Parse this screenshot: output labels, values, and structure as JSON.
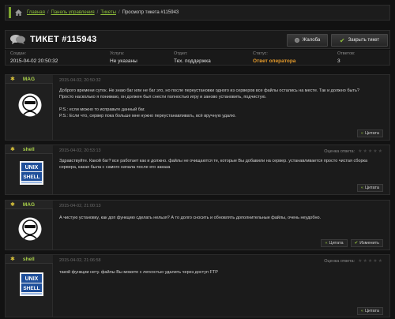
{
  "breadcrumb": {
    "home": "Главная",
    "panel": "Панель управления",
    "tickets": "Тикеты",
    "current": "Просмотр тикета #115943",
    "separator": "/"
  },
  "header": {
    "title": "ТИКЕТ #115943",
    "complaint_label": "Жалоба",
    "close_label": "Закрыть тикет"
  },
  "info": {
    "created_label": "Создан:",
    "created_value": "2015-04-02 20:50:32",
    "service_label": "Услуга:",
    "service_value": "Не указаны",
    "dept_label": "Отдел:",
    "dept_value": "Тех. поддержка",
    "status_label": "Статус:",
    "status_value": "Ответ оператора",
    "replies_label": "Ответов:",
    "replies_value": "3"
  },
  "messages": [
    {
      "author": "MAG",
      "date": "2015-04-02, 20:50:32",
      "lines": [
        "Доброго времени суток. Не знаю баг или не баг это, но после переустановки одного из серверов все файлы остались на месте. Так и должно быть?",
        "Просто насколько я понимаю, он должен был снести полностью игру и заново установить, подчистую.",
        "",
        "P.S.: если можно то исправьте данный баг.",
        "P.S.: Если что, сервер пока больше мне нужно переустанавливать, всё вручную удалю."
      ],
      "quote_label": "Цитата"
    },
    {
      "author": "shell",
      "date": "2015-04-02, 20:53:13",
      "rating_label": "Оценка ответа:",
      "lines": [
        "Здравствуйте. Какой баг? все работает как и должно. файлы не очищаются те, которые Вы добавили на сервер. устанавливается просто чистая сборка",
        "сервера, какая была с самого начала после его заказа"
      ],
      "quote_label": "Цитата"
    },
    {
      "author": "MAG",
      "date": "2015-04-02, 21:00:13",
      "lines": [
        "А чистую установку, как доп функцию сделать нельзя? А то долго сносить и обновлять дополнительные файлы, очень неудобно."
      ],
      "quote_label": "Цитата",
      "edit_label": "Изменить"
    },
    {
      "author": "shell",
      "date": "2015-04-02, 21:06:58",
      "rating_label": "Оценка ответа:",
      "lines": [
        "такой функции нету. файлы Вы можете с легкостью удалить через доступ FTP"
      ],
      "quote_label": "Цитата"
    }
  ],
  "colors": {
    "accent_green": "#8fbf3a",
    "status_orange": "#e49a2b",
    "background": "#121212"
  },
  "icons": {
    "home": "home-icon",
    "chat": "chat-bubbles-icon",
    "complaint": "circle-icon",
    "close": "check-icon",
    "quote": "quote-icon",
    "edit": "check-icon",
    "star": "star-icon"
  }
}
